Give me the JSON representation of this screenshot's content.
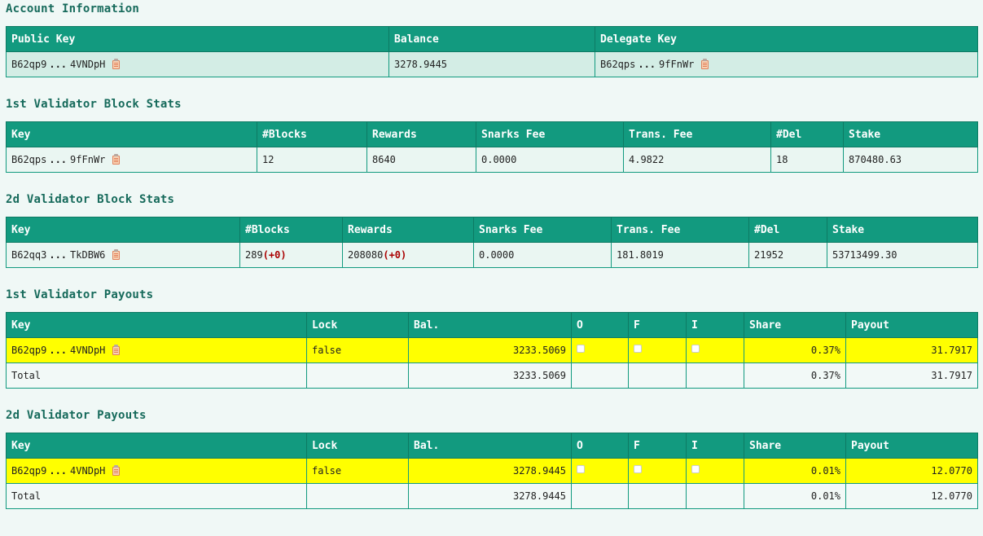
{
  "account": {
    "title": "Account Information",
    "headers": [
      "Public Key",
      "Balance",
      "Delegate Key"
    ],
    "public_key": {
      "start": "B62qp9",
      "end": "4VNDpH"
    },
    "balance": "3278.9445",
    "delegate_key": {
      "start": "B62qps",
      "end": "9fFnWr"
    }
  },
  "v1_stats": {
    "title": "1st Validator Block Stats",
    "headers": [
      "Key",
      "#Blocks",
      "Rewards",
      "Snarks Fee",
      "Trans. Fee",
      "#Del",
      "Stake"
    ],
    "key": {
      "start": "B62qps",
      "end": "9fFnWr"
    },
    "blocks": "12",
    "rewards": "8640",
    "snarks_fee": "0.0000",
    "trans_fee": "4.9822",
    "del": "18",
    "stake": "870480.63"
  },
  "v2_stats": {
    "title": "2d Validator Block Stats",
    "headers": [
      "Key",
      "#Blocks",
      "Rewards",
      "Snarks Fee",
      "Trans. Fee",
      "#Del",
      "Stake"
    ],
    "key": {
      "start": "B62qq3",
      "end": "TkDBW6"
    },
    "blocks": "289",
    "blocks_delta": "(+0)",
    "rewards": "208080",
    "rewards_delta": "(+0)",
    "snarks_fee": "0.0000",
    "trans_fee": "181.8019",
    "del": "21952",
    "stake": "53713499.30"
  },
  "v1_payouts": {
    "title": "1st Validator Payouts",
    "headers": [
      "Key",
      "Lock",
      "Bal.",
      "O",
      "F",
      "I",
      "Share",
      "Payout"
    ],
    "row": {
      "key": {
        "start": "B62qp9",
        "end": "4VNDpH"
      },
      "lock": "false",
      "bal": "3233.5069",
      "o": false,
      "f": false,
      "i": false,
      "share": "0.37%",
      "payout": "31.7917"
    },
    "total": {
      "label": "Total",
      "bal": "3233.5069",
      "share": "0.37%",
      "payout": "31.7917"
    }
  },
  "v2_payouts": {
    "title": "2d Validator Payouts",
    "headers": [
      "Key",
      "Lock",
      "Bal.",
      "O",
      "F",
      "I",
      "Share",
      "Payout"
    ],
    "row": {
      "key": {
        "start": "B62qp9",
        "end": "4VNDpH"
      },
      "lock": "false",
      "bal": "3278.9445",
      "o": false,
      "f": false,
      "i": false,
      "share": "0.01%",
      "payout": "12.0770"
    },
    "total": {
      "label": "Total",
      "bal": "3278.9445",
      "share": "0.01%",
      "payout": "12.0770"
    }
  },
  "ellipsis": "...",
  "icons": {
    "copy": "clipboard-icon",
    "checkbox": "checkbox"
  },
  "colors": {
    "header_bg": "#129a7f",
    "title_text": "#166a5b",
    "highlight_row": "#ffff00",
    "account_row": "#d3ede5",
    "delta_text": "#aa0000"
  }
}
